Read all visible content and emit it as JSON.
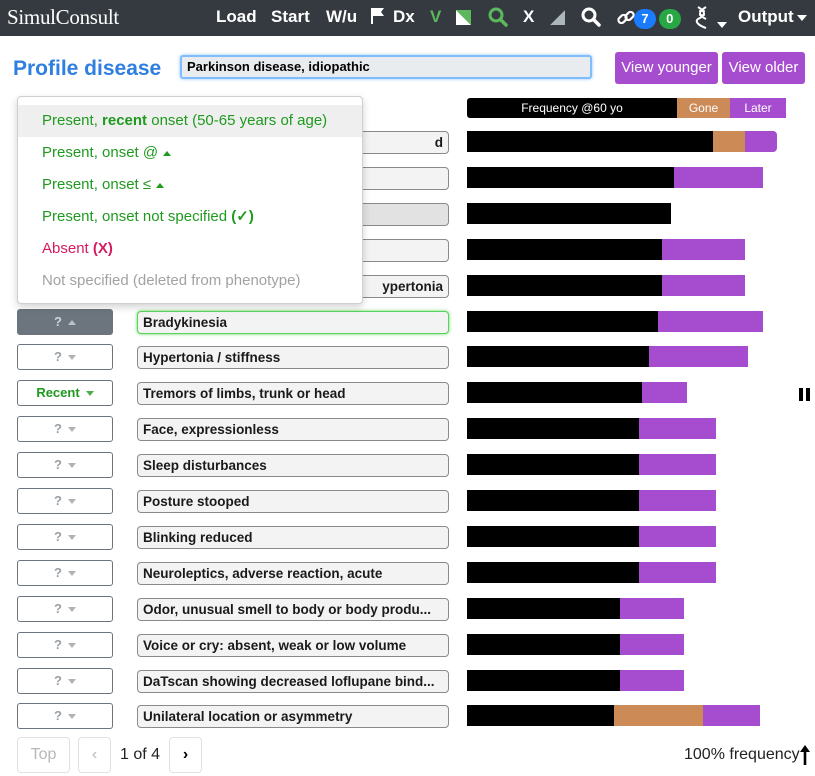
{
  "nav": {
    "logo": "SimulConsult",
    "items": [
      "Load",
      "Start",
      "W/u",
      "Dx",
      "V",
      "X",
      "Output"
    ],
    "badge_blue": "7",
    "badge_green": "0"
  },
  "header": {
    "title": "Profile disease",
    "disease_value": "Parkinson disease, idiopathic",
    "view_younger": "View younger",
    "view_older": "View older"
  },
  "legend": {
    "frequency": "Frequency @60 yo",
    "gone": "Gone",
    "later": "Later"
  },
  "colors": {
    "present_now": "#000000",
    "gone": "#cc8b56",
    "later": "#a64ccf",
    "accent_blue": "#2f7fe0",
    "present_green": "#1f9a1f",
    "absent_red": "#d81b60"
  },
  "menu": {
    "items": [
      {
        "prefix": "Present, ",
        "bold": "recent",
        "suffix": " onset (50-65 years of age)"
      },
      {
        "text": "Present, onset @"
      },
      {
        "text": "Present, onset ≤"
      },
      {
        "text": "Present, onset not specified ",
        "mark": "(✓)"
      },
      {
        "text": "Absent ",
        "mark": "(X)"
      },
      {
        "text": "Not specified (deleted from phenotype)"
      }
    ]
  },
  "findings": [
    {
      "status": "",
      "label": "d",
      "present": 0.77,
      "gone": 0.1,
      "later": 0.1
    },
    {
      "status": "",
      "label": "",
      "present": 0.65,
      "gone": 0,
      "later": 0.28
    },
    {
      "status": "",
      "label": "",
      "present": 0.64,
      "gone": 0,
      "later": 0
    },
    {
      "status": "",
      "label": "",
      "present": 0.61,
      "gone": 0,
      "later": 0.26
    },
    {
      "status": "",
      "label": "ypertonia",
      "present": 0.61,
      "gone": 0,
      "later": 0.26
    },
    {
      "status": "?",
      "label": "Bradykinesia",
      "present": 0.6,
      "gone": 0,
      "later": 0.33
    },
    {
      "status": "?",
      "label": "Hypertonia / stiffness",
      "present": 0.57,
      "gone": 0,
      "later": 0.31
    },
    {
      "status": "Recent",
      "label": "Tremors of limbs, trunk or head",
      "present": 0.55,
      "gone": 0,
      "later": 0.14
    },
    {
      "status": "?",
      "label": "Face, expressionless",
      "present": 0.54,
      "gone": 0,
      "later": 0.24
    },
    {
      "status": "?",
      "label": "Sleep disturbances",
      "present": 0.54,
      "gone": 0,
      "later": 0.24
    },
    {
      "status": "?",
      "label": "Posture stooped",
      "present": 0.54,
      "gone": 0,
      "later": 0.24
    },
    {
      "status": "?",
      "label": "Blinking reduced",
      "present": 0.54,
      "gone": 0,
      "later": 0.24
    },
    {
      "status": "?",
      "label": "Neuroleptics, adverse reaction, acute",
      "present": 0.54,
      "gone": 0,
      "later": 0.24
    },
    {
      "status": "?",
      "label": "Odor, unusual smell to body or body produ...",
      "present": 0.48,
      "gone": 0,
      "later": 0.2
    },
    {
      "status": "?",
      "label": "Voice or cry: absent, weak or low volume",
      "present": 0.48,
      "gone": 0,
      "later": 0.2
    },
    {
      "status": "?",
      "label": "DaTscan showing decreased loflupane bind...",
      "present": 0.48,
      "gone": 0,
      "later": 0.2
    },
    {
      "status": "?",
      "label": "Unilateral location or asymmetry",
      "present": 0.46,
      "gone": 0.28,
      "later": 0.18
    }
  ],
  "pagination": {
    "top": "Top",
    "prev": "‹",
    "page": "1 of 4",
    "next": "›",
    "frequency_label": "100% frequency"
  }
}
